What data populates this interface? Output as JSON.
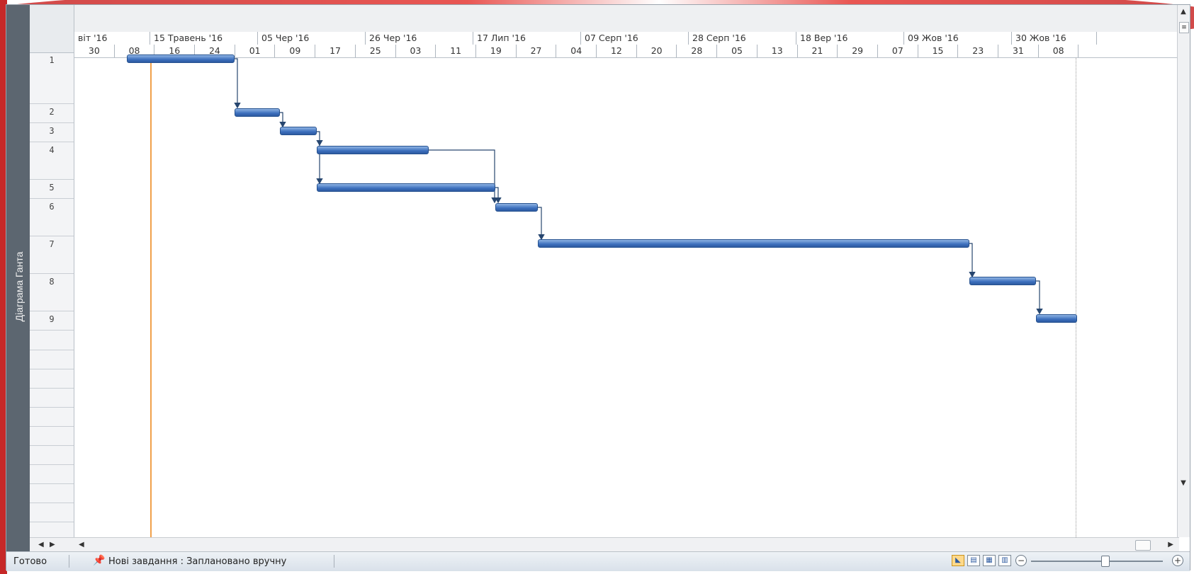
{
  "view_bar": {
    "label": "Діаграма Ганта"
  },
  "timescale": {
    "top_labels": [
      "віт '16",
      "15 Травень '16",
      "05 Чер '16",
      "26 Чер '16",
      "17 Лип '16",
      "07 Серп '16",
      "28 Серп '16",
      "18 Вер '16",
      "09 Жов '16",
      "30 Жов '16"
    ],
    "bottom_labels": [
      "30",
      "08",
      "16",
      "24",
      "01",
      "09",
      "17",
      "25",
      "03",
      "11",
      "19",
      "27",
      "04",
      "12",
      "20",
      "28",
      "05",
      "13",
      "21",
      "29",
      "07",
      "15",
      "23",
      "31",
      "08"
    ]
  },
  "rows": [
    {
      "id": "1"
    },
    {
      "id": "2"
    },
    {
      "id": "3"
    },
    {
      "id": "4"
    },
    {
      "id": "5"
    },
    {
      "id": "6"
    },
    {
      "id": "7"
    },
    {
      "id": "8"
    },
    {
      "id": "9"
    }
  ],
  "status_bar": {
    "ready": "Готово",
    "task_mode": "Нові завдання : Заплановано вручну"
  },
  "icons": {
    "pin": "pin-icon",
    "gantt_view": "gantt-view-icon",
    "task_usage": "task-usage-icon",
    "team_planner": "team-planner-icon",
    "resource_sheet": "resource-sheet-icon",
    "zoom_out": "zoom-out-icon",
    "zoom_in": "zoom-in-icon"
  },
  "colors": {
    "bar": "#3c6fbd",
    "today_line": "#f0a04b",
    "view_bar": "#5c6670"
  }
}
